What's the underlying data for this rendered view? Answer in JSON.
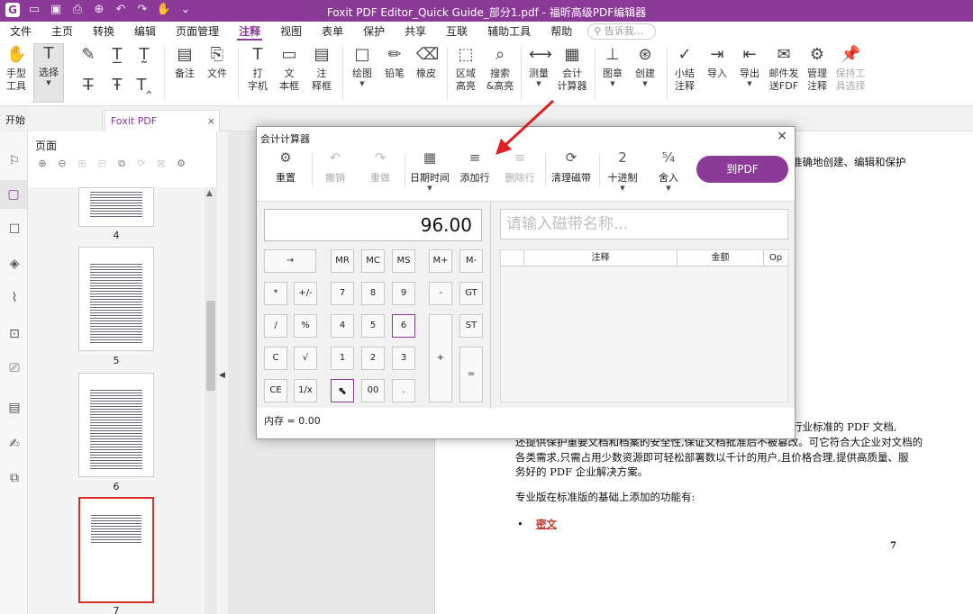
{
  "app": {
    "window_title": "Foxit PDF Editor_Quick Guide_部分1.pdf - 福昕高级PDF编辑器"
  },
  "menu_tabs": [
    "文件",
    "主页",
    "转换",
    "编辑",
    "页面管理",
    "注释",
    "视图",
    "表单",
    "保护",
    "共享",
    "互联",
    "辅助工具",
    "帮助"
  ],
  "active_menu_tab": "注释",
  "tell_me_placeholder": "告诉我...",
  "ribbon": {
    "hand_tool": {
      "line1": "手型",
      "line2": "工具"
    },
    "select": "选择",
    "note": "备注",
    "file": "文件",
    "typewriter": {
      "line1": "打",
      "line2": "字机"
    },
    "textbox": {
      "line1": "文",
      "line2": "本框"
    },
    "callout": {
      "line1": "注",
      "line2": "释框"
    },
    "drawing": "绘图",
    "pencil": "铅笔",
    "eraser": "橡皮",
    "area_highlight": {
      "line1": "区域",
      "line2": "高亮"
    },
    "search_highlight": {
      "line1": "搜索",
      "line2": "&高亮"
    },
    "measure": "测量",
    "accounting_calc": {
      "line1": "会计",
      "line2": "计算器"
    },
    "stamp": "图章",
    "create": "创建",
    "summarize": {
      "line1": "小结",
      "line2": "注释"
    },
    "import": "导入",
    "export": "导出",
    "email_send": {
      "line1": "邮件发",
      "line2": "送FDF"
    },
    "manage": {
      "line1": "管理",
      "line2": "注释"
    },
    "keep_tool": {
      "line1": "保持工",
      "line2": "具选择"
    }
  },
  "doc_tabs": {
    "start": "开始",
    "file": "Foxit PDF Editor_Quick...",
    "close": "×"
  },
  "pages_panel": {
    "title": "页面",
    "thumb_labels": [
      "4",
      "5",
      "6",
      "7"
    ]
  },
  "calculator": {
    "title": "会计计算器",
    "close": "×",
    "toolbar": {
      "reset": "重置",
      "undo": "撤销",
      "redo": "重做",
      "datetime": "日期时间",
      "add_row": "添加行",
      "delete_row": "删除行",
      "clear_tape": "清理磁带",
      "decimal": "十进制",
      "decimal_value": "2",
      "round": "舍入",
      "to_pdf": "到PDF"
    },
    "display_value": "96.00",
    "tape_name_placeholder": "请输入磁带名称...",
    "tape_headers": [
      "注释",
      "金额",
      "Op"
    ],
    "keys": {
      "arrow": "→",
      "mr": "MR",
      "mc": "MC",
      "ms": "MS",
      "mplus": "M+",
      "mminus": "M-",
      "mul": "*",
      "plusminus": "+/-",
      "k7": "7",
      "k8": "8",
      "k9": "9",
      "minus": "-",
      "gt": "GT",
      "div": "/",
      "pct": "%",
      "k4": "4",
      "k5": "5",
      "k6": "6",
      "st": "ST",
      "c": "C",
      "sqrt": "√",
      "k1": "1",
      "k2": "2",
      "k3": "3",
      "plus": "+",
      "eq": "=",
      "ce": "CE",
      "recip": "1/x",
      "k00": "00",
      "dot": "."
    },
    "memory": "内存 = 0.00"
  },
  "document": {
    "line_top": "准确地创建、编辑和保护",
    "line_a": "行业标准的 PDF 文档,",
    "line_b": "还提供保护重要文档和档案的安全性,保证文档批准后不被篡改。可它符合大企业对文档的",
    "line_c": "各类需求,只需占用少数资源即可轻松部署数以千计的用户,且价格合理,提供高质量、服",
    "line_d": "务好的 PDF 企业解决方案。",
    "line_e": "专业版在标准版的基础上添加的功能有:",
    "bullet": "•",
    "link": "密文",
    "page_number": "7"
  },
  "colors": {
    "brand": "#8b3a97",
    "annotation_arrow": "#e02020",
    "link": "#c0392b"
  }
}
